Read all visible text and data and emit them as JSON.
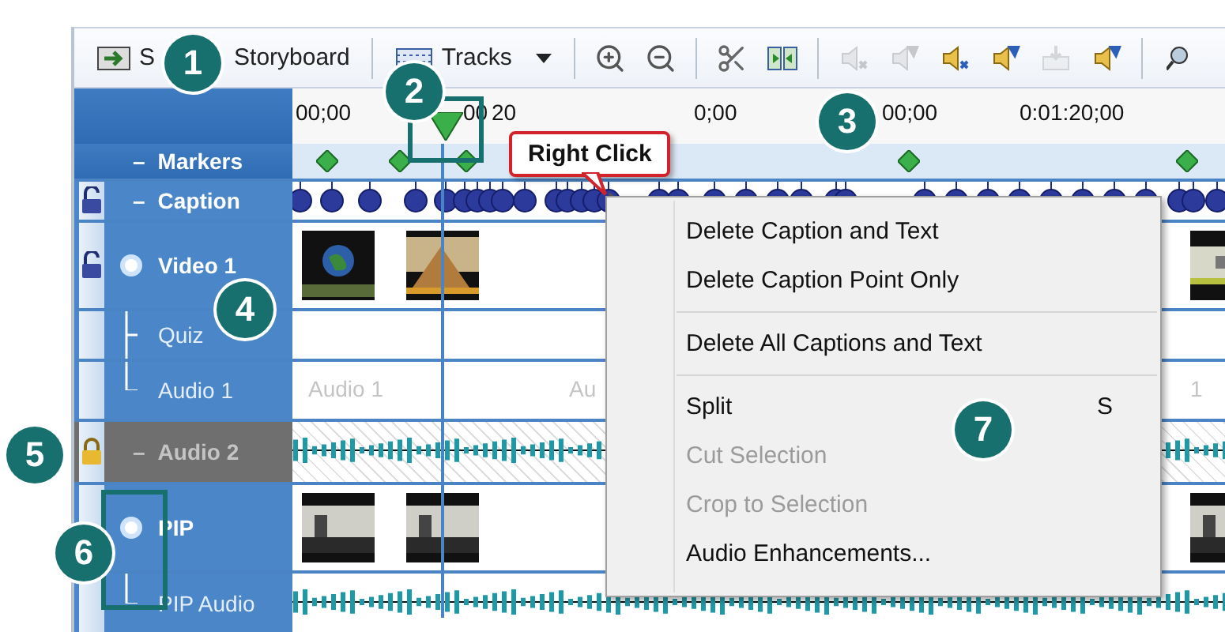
{
  "toolbar": {
    "storyboard_button": {
      "label_start": "S",
      "label_end": "Storyboard"
    },
    "tracks_button": {
      "label": "Tracks"
    },
    "tools": [
      {
        "kind": "zoom-in",
        "disabled": false
      },
      {
        "kind": "zoom-out",
        "disabled": false
      },
      {
        "kind": "separator"
      },
      {
        "kind": "scissors",
        "disabled": false
      },
      {
        "kind": "split",
        "disabled": false
      },
      {
        "kind": "separator"
      },
      {
        "kind": "speaker",
        "disabled": true
      },
      {
        "kind": "speaker",
        "disabled": true
      },
      {
        "kind": "speaker",
        "disabled": false
      },
      {
        "kind": "speaker",
        "disabled": false
      },
      {
        "kind": "tray",
        "disabled": true
      },
      {
        "kind": "speaker",
        "disabled": false
      },
      {
        "kind": "separator"
      },
      {
        "kind": "magnifier",
        "disabled": false
      }
    ]
  },
  "ruler": {
    "labels": [
      "00;00",
      "00",
      "20",
      "0;00",
      "00;00",
      "0:01:20;00"
    ]
  },
  "tracks": [
    {
      "name": "Markers",
      "kind": "markers",
      "prefix": "–",
      "disabled": false
    },
    {
      "name": "Caption",
      "kind": "captions",
      "prefix": "–",
      "locked": false,
      "disabled": false
    },
    {
      "name": "Video 1",
      "kind": "video",
      "locked": false,
      "disabled": false,
      "clips": [
        {
          "kind": "picture"
        },
        {
          "kind": "picture"
        },
        {
          "kind": "picture"
        }
      ],
      "children": [
        {
          "name": "Quiz",
          "kind": "quiz",
          "disabled": false
        },
        {
          "name": "Audio 1",
          "kind": "audio-text",
          "disabled": false,
          "clip_texts": [
            "Audio 1",
            "Au",
            "1"
          ]
        }
      ]
    },
    {
      "name": "Audio 2",
      "kind": "audio",
      "prefix": "–",
      "locked": true,
      "disabled": true
    },
    {
      "name": "PIP",
      "kind": "video",
      "disabled": false,
      "clips": [
        {
          "kind": "picture"
        },
        {
          "kind": "picture"
        },
        {
          "kind": "picture"
        }
      ],
      "children": [
        {
          "name": "PIP Audio",
          "kind": "audio",
          "disabled": false
        }
      ]
    }
  ],
  "callout": {
    "text": "Right Click"
  },
  "context_menu": [
    {
      "kind": "item",
      "label": "Delete Caption and Text",
      "disabled": false
    },
    {
      "kind": "item",
      "label": "Delete Caption Point Only",
      "disabled": false
    },
    {
      "kind": "separator"
    },
    {
      "kind": "item",
      "label": "Delete All Captions and Text",
      "disabled": false
    },
    {
      "kind": "separator"
    },
    {
      "kind": "item",
      "label": "Split",
      "shortcut": "S",
      "disabled": false
    },
    {
      "kind": "item",
      "label": "Cut Selection",
      "disabled": true
    },
    {
      "kind": "item",
      "label": "Crop to Selection",
      "disabled": true
    },
    {
      "kind": "item",
      "label": "Audio Enhancements...",
      "disabled": false
    }
  ],
  "badges": [
    "1",
    "2",
    "3",
    "4",
    "5",
    "6",
    "7"
  ]
}
